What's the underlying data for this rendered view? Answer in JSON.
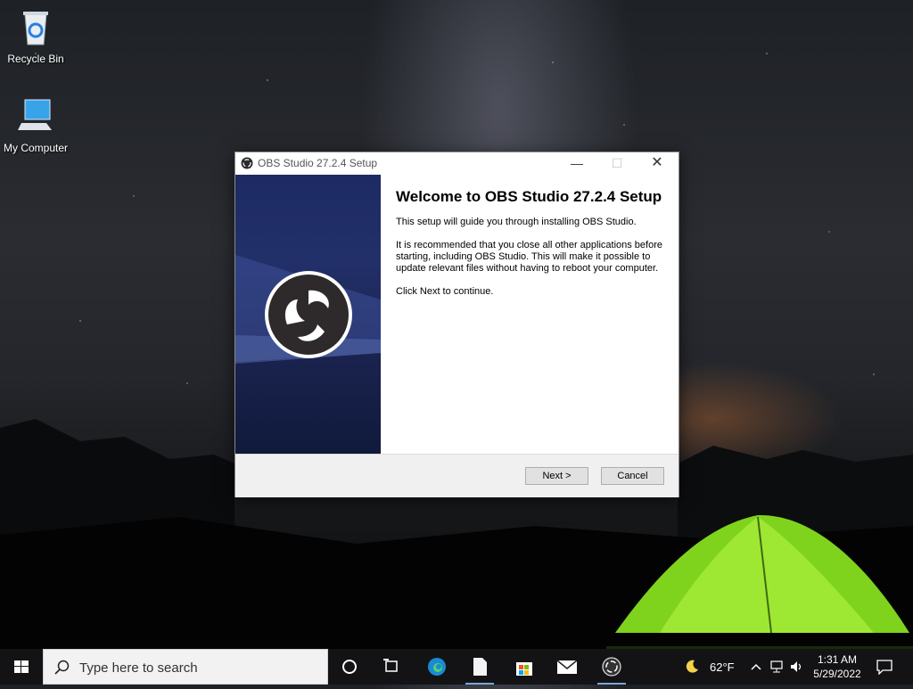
{
  "desktop": {
    "icons": [
      {
        "label": "Recycle Bin",
        "icon": "recycle-bin-icon"
      },
      {
        "label": "My Computer",
        "icon": "computer-icon"
      }
    ]
  },
  "window": {
    "title": "OBS Studio 27.2.4 Setup",
    "heading": "Welcome to OBS Studio 27.2.4 Setup",
    "paragraphs": [
      "This setup will guide you through installing OBS Studio.",
      "It is recommended that you close all other applications before starting, including OBS Studio. This will make it possible to update relevant files without having to reboot your computer.",
      "Click Next to continue."
    ],
    "controls": {
      "minimize": "—",
      "maximize": "☐",
      "close": "✕"
    },
    "buttons": {
      "next": "Next >",
      "cancel": "Cancel"
    },
    "accent_color": "#1d2a63"
  },
  "taskbar": {
    "search_placeholder": "Type here to search",
    "apps": [
      "cortana-icon",
      "task-view-icon",
      "edge-icon",
      "file-icon",
      "store-icon",
      "mail-icon",
      "obs-icon"
    ],
    "weather": "62°F",
    "time": "1:31 AM",
    "date": "5/29/2022"
  }
}
